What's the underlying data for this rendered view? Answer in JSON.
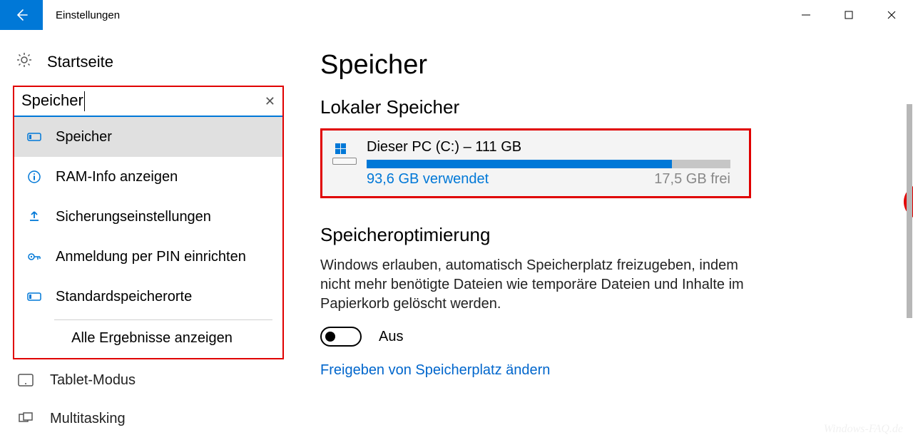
{
  "titlebar": {
    "title": "Einstellungen"
  },
  "sidebar": {
    "home": "Startseite",
    "search_value": "Speicher",
    "suggestions": [
      {
        "icon": "storage",
        "label": "Speicher"
      },
      {
        "icon": "info",
        "label": "RAM-Info anzeigen"
      },
      {
        "icon": "backup",
        "label": "Sicherungseinstellungen"
      },
      {
        "icon": "pin",
        "label": "Anmeldung per PIN einrichten"
      },
      {
        "icon": "storage",
        "label": "Standardspeicherorte"
      }
    ],
    "all_results": "Alle Ergebnisse anzeigen",
    "nav_below": [
      {
        "label": "Tablet-Modus"
      },
      {
        "label": "Multitasking"
      }
    ]
  },
  "main": {
    "h1": "Speicher",
    "local_h2": "Lokaler Speicher",
    "drive": {
      "title": "Dieser PC (C:) – 111 GB",
      "used": "93,6 GB verwendet",
      "free": "17,5 GB frei",
      "used_pct": 84
    },
    "opt_h2": "Speicheroptimierung",
    "opt_desc": "Windows erlauben, automatisch Speicherplatz freizugeben, indem nicht mehr benötigte Dateien wie temporäre Dateien und Inhalte im Papierkorb gelöscht werden.",
    "toggle_label": "Aus",
    "link": "Freigeben von Speicherplatz ändern"
  },
  "watermark": "Windows-FAQ.de"
}
